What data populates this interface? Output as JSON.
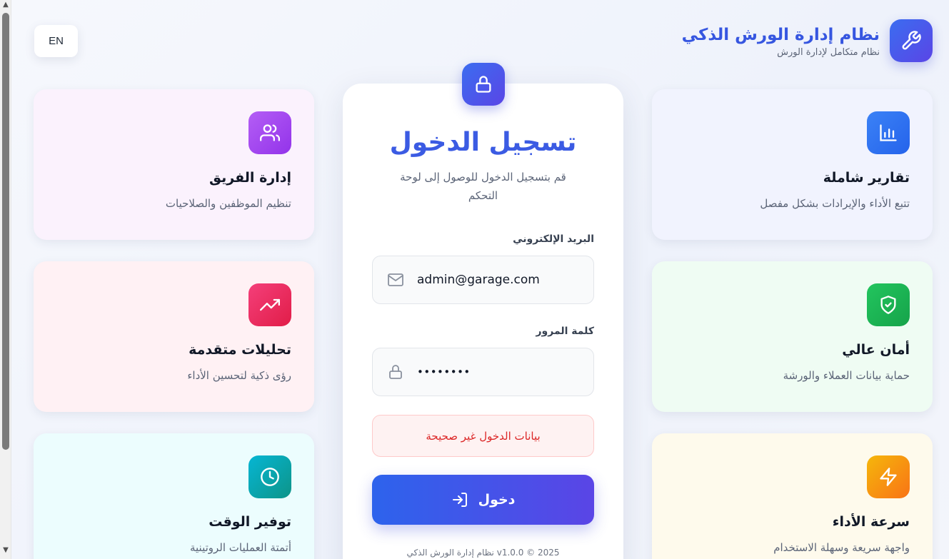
{
  "header": {
    "lang_button": "EN",
    "brand_title": "نظام إدارة الورش الذكي",
    "brand_subtitle": "نظام متكامل لإدارة الورش",
    "logo_icon": "wrench-icon"
  },
  "features": {
    "reports": {
      "title": "تقارير شاملة",
      "desc": "تتبع الأداء والإيرادات بشكل مفصل",
      "icon": "bar-chart-icon",
      "color": "#2f6fef",
      "bg": "#f1f3fe"
    },
    "security": {
      "title": "أمان عالي",
      "desc": "حماية بيانات العملاء والورشة",
      "icon": "shield-check-icon",
      "color": "#16a34a",
      "bg": "#effcf3"
    },
    "speed": {
      "title": "سرعة الأداء",
      "desc": "واجهة سريعة وسهلة الاستخدام",
      "icon": "lightning-icon",
      "color": "#f59e0b",
      "bg": "#fefaec"
    },
    "team": {
      "title": "إدارة الفريق",
      "desc": "تنظيم الموظفين والصلاحيات",
      "icon": "users-icon",
      "color": "#a855f7",
      "bg": "#fbf2fd"
    },
    "analytics": {
      "title": "تحليلات متقدمة",
      "desc": "رؤى ذكية لتحسين الأداء",
      "icon": "trending-up-icon",
      "color": "#e11d62",
      "bg": "#fff1f4"
    },
    "time": {
      "title": "توفير الوقت",
      "desc": "أتمتة العمليات الروتينية",
      "icon": "clock-icon",
      "color": "#0891b2",
      "bg": "#ecfdfe"
    }
  },
  "login": {
    "title": "تسجيل الدخول",
    "subtitle": "قم بتسجيل الدخول للوصول إلى لوحة التحكم",
    "email_label": "البريد الإلكتروني",
    "email_value": "admin@garage.com",
    "password_label": "كلمة المرور",
    "password_value": "••••••••",
    "error": "بيانات الدخول غير صحيحة",
    "submit": "دخول",
    "footer": "2025 © v1.0.0 نظام إدارة الورش الذكي"
  }
}
